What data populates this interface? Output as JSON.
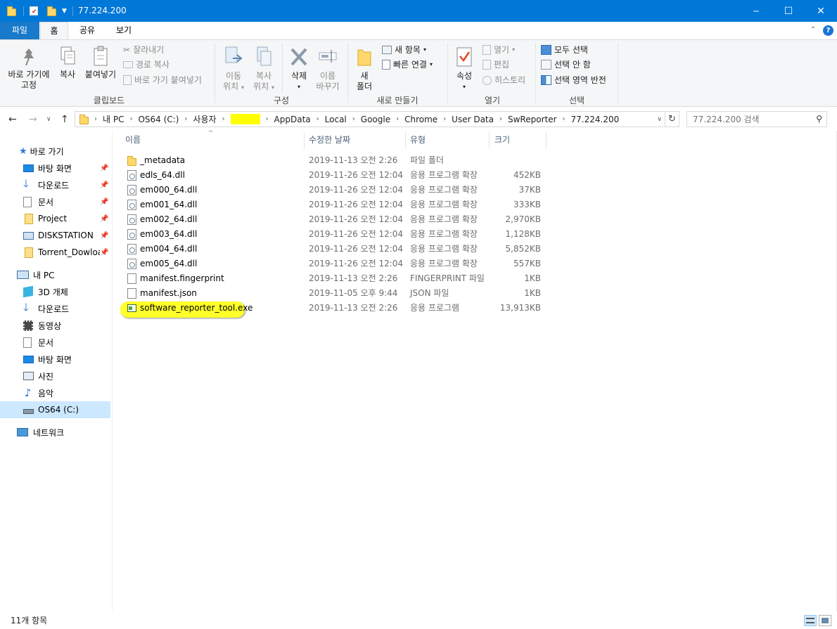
{
  "window": {
    "title": "77.224.200",
    "minimize_glyph": "─",
    "maximize_glyph": "☐",
    "close_glyph": "✕"
  },
  "ribbon_tabs": [
    {
      "label": "파일"
    },
    {
      "label": "홈"
    },
    {
      "label": "공유"
    },
    {
      "label": "보기"
    }
  ],
  "ribbon": {
    "clipboard": {
      "pin_label_1": "바로 가기에",
      "pin_label_2": "고정",
      "copy_label": "복사",
      "paste_label": "붙여넣기",
      "cut_label": "잘라내기",
      "copy_path_label": "경로 복사",
      "paste_shortcut_label": "바로 가기 붙여넣기",
      "group_label": "클립보드"
    },
    "organize": {
      "move_label_1": "이동",
      "move_label_2": "위치",
      "copyto_label_1": "복사",
      "copyto_label_2": "위치",
      "delete_label": "삭제",
      "rename_label_1": "이름",
      "rename_label_2": "바꾸기",
      "group_label": "구성"
    },
    "new": {
      "new_folder_label_1": "새",
      "new_folder_label_2": "폴더",
      "new_item_label": "새 항목",
      "easy_access_label": "빠른 연결",
      "group_label": "새로 만들기"
    },
    "open": {
      "properties_label": "속성",
      "open_label": "열기",
      "edit_label": "편집",
      "history_label": "히스토리",
      "group_label": "열기"
    },
    "select": {
      "select_all_label": "모두 선택",
      "select_none_label": "선택 안 함",
      "invert_label": "선택 영역 반전",
      "group_label": "선택"
    }
  },
  "address": {
    "crumbs": [
      "내 PC",
      "OS64 (C:)",
      "사용자",
      "",
      "AppData",
      "Local",
      "Google",
      "Chrome",
      "User Data",
      "SwReporter",
      "77.224.200"
    ],
    "redacted_color": "#ffff00",
    "search_placeholder": "77.224.200 검색"
  },
  "sidebar": {
    "quick_access": "바로 가기",
    "quick_items": [
      {
        "label": "바탕 화면",
        "icon": "desktop-icon"
      },
      {
        "label": "다운로드",
        "icon": "download-icon"
      },
      {
        "label": "문서",
        "icon": "documents-icon"
      },
      {
        "label": "Project",
        "icon": "folder-icon"
      },
      {
        "label": "DISKSTATION",
        "icon": "network-drive-icon"
      },
      {
        "label": "Torrent_Dowloads",
        "icon": "folder-icon"
      }
    ],
    "this_pc": "내 PC",
    "pc_items": [
      {
        "label": "3D 개체",
        "icon": "3d-objects-icon"
      },
      {
        "label": "다운로드",
        "icon": "download-icon"
      },
      {
        "label": "동영상",
        "icon": "video-icon"
      },
      {
        "label": "문서",
        "icon": "documents-icon"
      },
      {
        "label": "바탕 화면",
        "icon": "desktop-icon"
      },
      {
        "label": "사진",
        "icon": "pictures-icon"
      },
      {
        "label": "음악",
        "icon": "music-icon"
      },
      {
        "label": "OS64 (C:)",
        "icon": "drive-icon"
      }
    ],
    "network": "네트워크"
  },
  "columns": {
    "name": "이름",
    "date": "수정한 날짜",
    "type": "유형",
    "size": "크기"
  },
  "files": [
    {
      "name": "_metadata",
      "date": "2019-11-13 오전 2:26",
      "type": "파일 폴더",
      "size": "",
      "icon": "folder-icon"
    },
    {
      "name": "edls_64.dll",
      "date": "2019-11-26 오전 12:04",
      "type": "응용 프로그램 확장",
      "size": "452KB",
      "icon": "dll-icon"
    },
    {
      "name": "em000_64.dll",
      "date": "2019-11-26 오전 12:04",
      "type": "응용 프로그램 확장",
      "size": "37KB",
      "icon": "dll-icon"
    },
    {
      "name": "em001_64.dll",
      "date": "2019-11-26 오전 12:04",
      "type": "응용 프로그램 확장",
      "size": "333KB",
      "icon": "dll-icon"
    },
    {
      "name": "em002_64.dll",
      "date": "2019-11-26 오전 12:04",
      "type": "응용 프로그램 확장",
      "size": "2,970KB",
      "icon": "dll-icon"
    },
    {
      "name": "em003_64.dll",
      "date": "2019-11-26 오전 12:04",
      "type": "응용 프로그램 확장",
      "size": "1,128KB",
      "icon": "dll-icon"
    },
    {
      "name": "em004_64.dll",
      "date": "2019-11-26 오전 12:04",
      "type": "응용 프로그램 확장",
      "size": "5,852KB",
      "icon": "dll-icon"
    },
    {
      "name": "em005_64.dll",
      "date": "2019-11-26 오전 12:04",
      "type": "응용 프로그램 확장",
      "size": "557KB",
      "icon": "dll-icon"
    },
    {
      "name": "manifest.fingerprint",
      "date": "2019-11-13 오전 2:26",
      "type": "FINGERPRINT 파일",
      "size": "1KB",
      "icon": "file-icon"
    },
    {
      "name": "manifest.json",
      "date": "2019-11-05 오후 9:44",
      "type": "JSON 파일",
      "size": "1KB",
      "icon": "file-icon"
    },
    {
      "name": "software_reporter_tool.exe",
      "date": "2019-11-13 오전 2:26",
      "type": "응용 프로그램",
      "size": "13,913KB",
      "icon": "exe-icon",
      "highlighted": true
    }
  ],
  "status": {
    "count": "11개 항목"
  },
  "colors": {
    "titlebar": "#0078d7",
    "file_tab": "#1979ca",
    "highlight": "#ffff2a",
    "selected_nav": "#cce8ff"
  }
}
